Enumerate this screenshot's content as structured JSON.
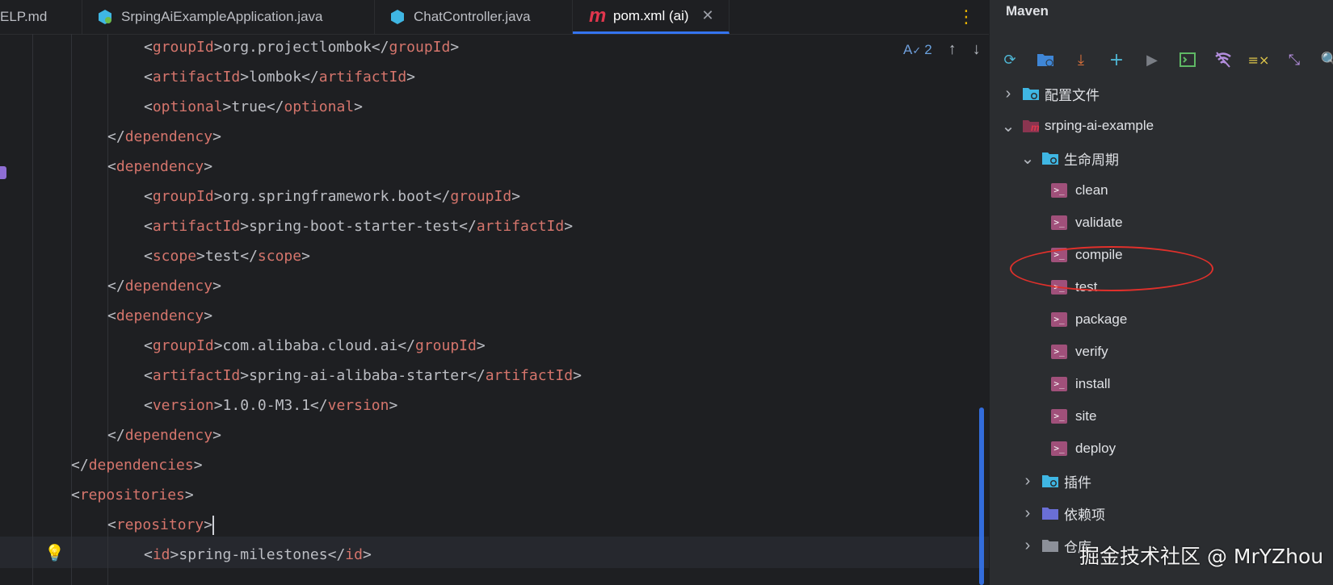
{
  "tabs": [
    {
      "label": "ELP.md",
      "icon": "markdown-icon"
    },
    {
      "label": "SrpingAiExampleApplication.java",
      "icon": "spring-app-icon"
    },
    {
      "label": "ChatController.java",
      "icon": "java-class-icon"
    },
    {
      "label": "pom.xml (ai)",
      "icon": "maven-icon",
      "active": true
    }
  ],
  "inspection": {
    "count": "2"
  },
  "code_lines": [
    {
      "indent": 2,
      "open": "groupId",
      "text": "org.projectlombok",
      "close": "groupId"
    },
    {
      "indent": 2,
      "open": "artifactId",
      "text": "lombok",
      "close": "artifactId"
    },
    {
      "indent": 2,
      "open": "optional",
      "text": "true",
      "close": "optional"
    },
    {
      "indent": 1,
      "closeonly": "dependency"
    },
    {
      "indent": 1,
      "openonly": "dependency"
    },
    {
      "indent": 2,
      "open": "groupId",
      "text": "org.springframework.boot",
      "close": "groupId"
    },
    {
      "indent": 2,
      "open": "artifactId",
      "text": "spring-boot-starter-test",
      "close": "artifactId"
    },
    {
      "indent": 2,
      "open": "scope",
      "text": "test",
      "close": "scope"
    },
    {
      "indent": 1,
      "closeonly": "dependency"
    },
    {
      "indent": 1,
      "openonly": "dependency"
    },
    {
      "indent": 2,
      "open": "groupId",
      "text": "com.alibaba.cloud.ai",
      "close": "groupId"
    },
    {
      "indent": 2,
      "open": "artifactId",
      "text": "spring-ai-alibaba-starter",
      "close": "artifactId"
    },
    {
      "indent": 2,
      "open": "version",
      "text": "1.0.0-M3.1",
      "close": "version"
    },
    {
      "indent": 1,
      "closeonly": "dependency"
    },
    {
      "indent": 0,
      "closeonly": "dependencies"
    },
    {
      "indent": 0,
      "openonly": "repositories"
    },
    {
      "indent": 1,
      "openonly": "repository",
      "caret": true
    },
    {
      "indent": 2,
      "open": "id",
      "text": "spring-milestones",
      "close": "id"
    }
  ],
  "maven": {
    "title": "Maven",
    "toolbar": [
      "reload-icon",
      "folder-refresh-icon",
      "download-icon",
      "plus-icon",
      "run-icon",
      "terminal-icon",
      "skip-tests-icon",
      "toggle-offline-icon",
      "collapse-icon",
      "search-icon"
    ],
    "tree": [
      {
        "label": "配置文件",
        "depth": 0,
        "chevron": "›",
        "icon": "folder-config-icon"
      },
      {
        "label": "srping-ai-example",
        "depth": 0,
        "chevron": "⌄",
        "icon": "maven-project-icon"
      },
      {
        "label": "生命周期",
        "depth": 1,
        "chevron": "⌄",
        "icon": "folder-config-icon"
      },
      {
        "label": "clean",
        "depth": 2,
        "icon": "goal-icon"
      },
      {
        "label": "validate",
        "depth": 2,
        "icon": "goal-icon"
      },
      {
        "label": "compile",
        "depth": 2,
        "icon": "goal-icon"
      },
      {
        "label": "test",
        "depth": 2,
        "icon": "goal-icon"
      },
      {
        "label": "package",
        "depth": 2,
        "icon": "goal-icon"
      },
      {
        "label": "verify",
        "depth": 2,
        "icon": "goal-icon"
      },
      {
        "label": "install",
        "depth": 2,
        "icon": "goal-icon"
      },
      {
        "label": "site",
        "depth": 2,
        "icon": "goal-icon"
      },
      {
        "label": "deploy",
        "depth": 2,
        "icon": "goal-icon"
      },
      {
        "label": "插件",
        "depth": 1,
        "chevron": "›",
        "icon": "folder-config-icon"
      },
      {
        "label": "依赖项",
        "depth": 1,
        "chevron": "›",
        "icon": "folder-deps-icon"
      },
      {
        "label": "仓库",
        "depth": 1,
        "chevron": "›",
        "icon": "folder-repo-icon"
      }
    ]
  },
  "watermark": "掘金技术社区 @ MrYZhou",
  "colors": {
    "tag": "#d5756c",
    "accent": "#3574f0",
    "annotation_oval": "#e0302b"
  }
}
